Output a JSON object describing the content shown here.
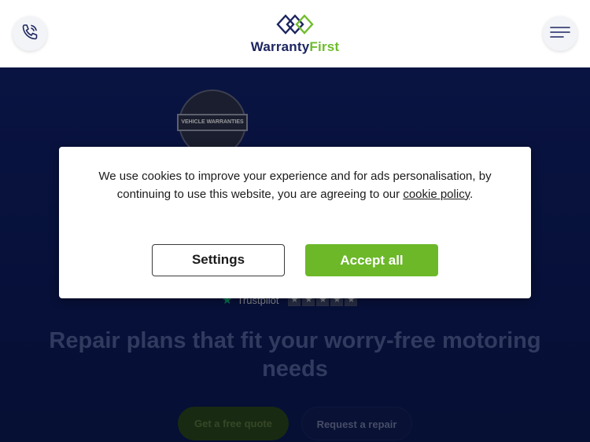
{
  "header": {
    "logo": {
      "text_part1": "Warranty",
      "text_part2": "First",
      "navy_color": "#1c2560",
      "green_color": "#6ebd2b"
    },
    "phone_icon": "phone-icon",
    "menu_icon": "hamburger-menu-icon"
  },
  "hero": {
    "badge_text": "VEHICLE WARRANTIES",
    "trustpilot_text": "Trustpilot",
    "headline": "Repair plans that fit your worry-free motoring needs",
    "cta_quote": "Get a free quote",
    "cta_repair": "Request a repair"
  },
  "cookie": {
    "text_before_link": "We use cookies to improve your experience and for ads personalisation, by continuing to use this website, you are agreeing to our ",
    "link_text": "cookie policy",
    "text_after_link": ".",
    "settings_label": "Settings",
    "accept_label": "Accept all",
    "accent_color": "#6cb829"
  }
}
